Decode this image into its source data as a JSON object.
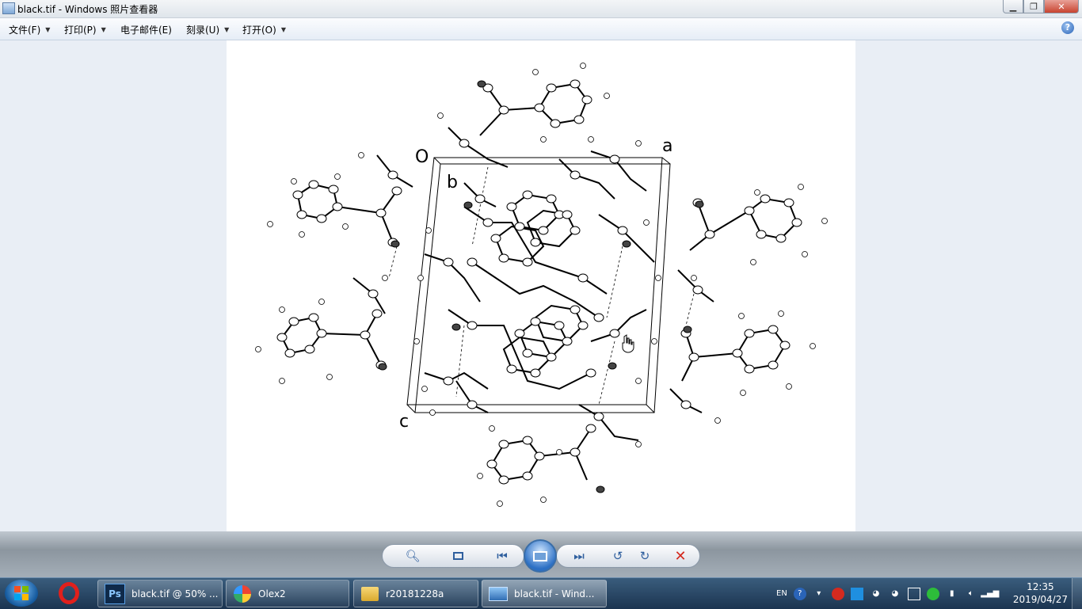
{
  "window": {
    "title": "black.tif - Windows 照片查看器",
    "minimize_label": "▁",
    "maximize_label": "❐",
    "close_label": "✕"
  },
  "menu": {
    "items": [
      {
        "label": "文件(F)",
        "has_dropdown": true
      },
      {
        "label": "打印(P)",
        "has_dropdown": true
      },
      {
        "label": "电子邮件(E)",
        "has_dropdown": false
      },
      {
        "label": "刻录(U)",
        "has_dropdown": true
      },
      {
        "label": "打开(O)",
        "has_dropdown": true
      }
    ],
    "help_label": "?"
  },
  "image": {
    "axis_labels": {
      "o": "O",
      "a": "a",
      "b": "b",
      "c": "c"
    }
  },
  "controls": {
    "buttons": [
      "zoom-icon",
      "actual-size-icon",
      "previous-icon",
      "slideshow-icon",
      "next-icon",
      "rotate-ccw-icon",
      "rotate-cw-icon",
      "delete-icon"
    ]
  },
  "taskbar": {
    "items": [
      {
        "label": "black.tif @ 50% ...",
        "icon": "photoshop-icon",
        "icon_text": "Ps"
      },
      {
        "label": "Olex2",
        "icon": "olex2-icon",
        "icon_text": ""
      },
      {
        "label": "r20181228a",
        "icon": "folder-icon",
        "icon_text": ""
      },
      {
        "label": "black.tif - Wind...",
        "icon": "photo-viewer-icon",
        "icon_text": ""
      }
    ],
    "tray": {
      "language": "EN",
      "time": "12:35",
      "date": "2019/04/27"
    }
  },
  "colors": {
    "taskbar": "#1b3450",
    "delete": "#d42a1f",
    "accent": "#2b6fc4"
  }
}
